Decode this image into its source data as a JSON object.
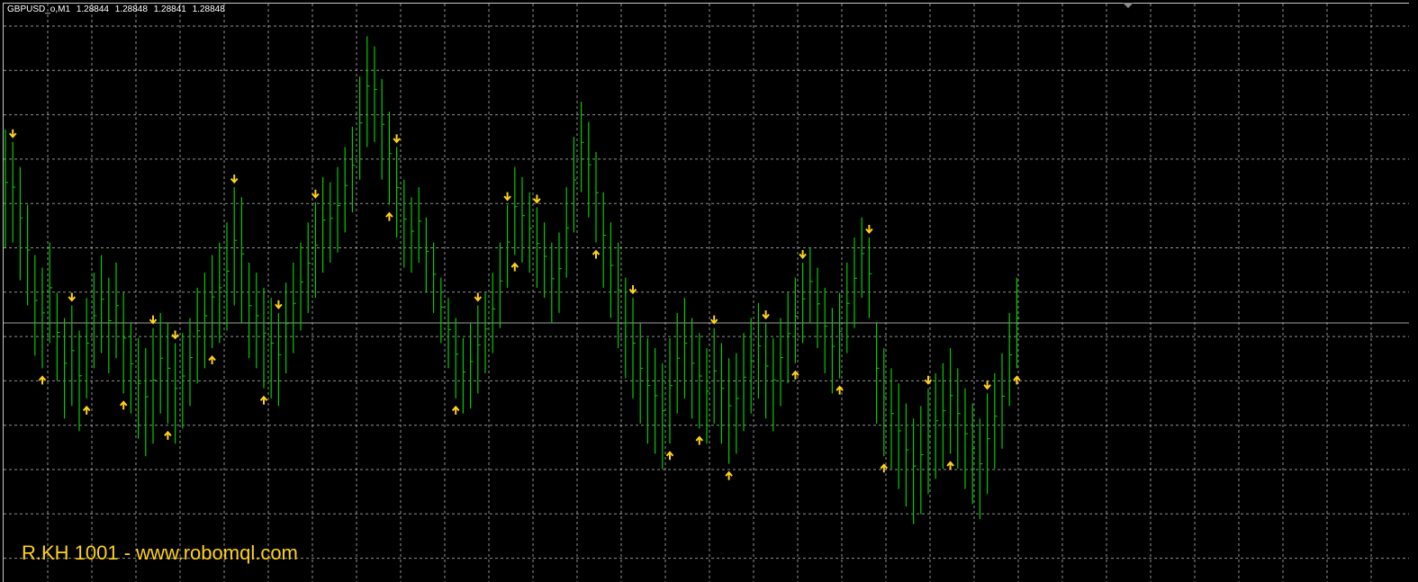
{
  "chart": {
    "symbol": "GBPUSD_o,M1",
    "open": "1.28844",
    "high": "1.28848",
    "low": "1.28841",
    "close": "1.28848",
    "watermark": "R.KH 1001 - www.robomql.com",
    "current_price": 1.28848,
    "colors": {
      "background": "#000000",
      "grid": "#c0c0c0",
      "bars": "#00cc00",
      "signals": "#ffd21a",
      "price_line": "#a0a0a0",
      "watermark": "#ffd21a"
    },
    "icons": {
      "buy_signal": "arrow-up-icon",
      "sell_signal": "arrow-down-icon",
      "shift": "chart-shift-triangle-icon"
    }
  },
  "chart_data": {
    "type": "ohlc",
    "title": "GBPUSD_o,M1",
    "grid": true,
    "ylim": [
      1.28745,
      1.28975
    ],
    "bars": [
      [
        1.28925,
        1.28878
      ],
      [
        1.2892,
        1.2888
      ],
      [
        1.2891,
        1.28865
      ],
      [
        1.28895,
        1.28855
      ],
      [
        1.28875,
        1.28835
      ],
      [
        1.2887,
        1.2883
      ],
      [
        1.2888,
        1.2884
      ],
      [
        1.2886,
        1.28825
      ],
      [
        1.2885,
        1.2881
      ],
      [
        1.28855,
        1.28815
      ],
      [
        1.28845,
        1.28805
      ],
      [
        1.28858,
        1.28818
      ],
      [
        1.28868,
        1.2883
      ],
      [
        1.28875,
        1.28836
      ],
      [
        1.28866,
        1.28828
      ],
      [
        1.28872,
        1.28834
      ],
      [
        1.2886,
        1.2882
      ],
      [
        1.28848,
        1.28812
      ],
      [
        1.28842,
        1.28802
      ],
      [
        1.28838,
        1.28795
      ],
      [
        1.28846,
        1.288
      ],
      [
        1.28852,
        1.28812
      ],
      [
        1.28848,
        1.28808
      ],
      [
        1.2884,
        1.288
      ],
      [
        1.28844,
        1.28806
      ],
      [
        1.2885,
        1.28815
      ],
      [
        1.28862,
        1.28824
      ],
      [
        1.28868,
        1.2883
      ],
      [
        1.28875,
        1.28838
      ],
      [
        1.2888,
        1.2884
      ],
      [
        1.28888,
        1.28845
      ],
      [
        1.28902,
        1.28855
      ],
      [
        1.28898,
        1.28848
      ],
      [
        1.28872,
        1.28834
      ],
      [
        1.28868,
        1.2883
      ],
      [
        1.28862,
        1.28822
      ],
      [
        1.28858,
        1.28818
      ],
      [
        1.28852,
        1.28815
      ],
      [
        1.28864,
        1.28828
      ],
      [
        1.28872,
        1.28836
      ],
      [
        1.2888,
        1.28845
      ],
      [
        1.28888,
        1.28852
      ],
      [
        1.28896,
        1.28858
      ],
      [
        1.28906,
        1.28868
      ],
      [
        1.28904,
        1.28872
      ],
      [
        1.2891,
        1.28876
      ],
      [
        1.28918,
        1.28884
      ],
      [
        1.28926,
        1.28892
      ],
      [
        1.28946,
        1.28905
      ],
      [
        1.28962,
        1.28918
      ],
      [
        1.28958,
        1.2892
      ],
      [
        1.28945,
        1.28905
      ],
      [
        1.28932,
        1.28895
      ],
      [
        1.28918,
        1.28882
      ],
      [
        1.28905,
        1.2887
      ],
      [
        1.28898,
        1.28868
      ],
      [
        1.28902,
        1.28872
      ],
      [
        1.2889,
        1.2886
      ],
      [
        1.2888,
        1.28852
      ],
      [
        1.28866,
        1.2884
      ],
      [
        1.28858,
        1.2883
      ],
      [
        1.2885,
        1.28818
      ],
      [
        1.28842,
        1.28812
      ],
      [
        1.28848,
        1.28814
      ],
      [
        1.28855,
        1.2882
      ],
      [
        1.2886,
        1.28828
      ],
      [
        1.28868,
        1.28836
      ],
      [
        1.2888,
        1.28846
      ],
      [
        1.28895,
        1.28862
      ],
      [
        1.2891,
        1.28875
      ],
      [
        1.28906,
        1.28872
      ],
      [
        1.289,
        1.28868
      ],
      [
        1.28894,
        1.28862
      ],
      [
        1.28888,
        1.28858
      ],
      [
        1.2888,
        1.28848
      ],
      [
        1.28884,
        1.28852
      ],
      [
        1.28902,
        1.28866
      ],
      [
        1.28922,
        1.28884
      ],
      [
        1.28936,
        1.289
      ],
      [
        1.28928,
        1.2889
      ],
      [
        1.28916,
        1.2888
      ],
      [
        1.289,
        1.28862
      ],
      [
        1.28888,
        1.2885
      ],
      [
        1.2888,
        1.28838
      ],
      [
        1.28866,
        1.28826
      ],
      [
        1.28858,
        1.28818
      ],
      [
        1.28848,
        1.28808
      ],
      [
        1.28842,
        1.288
      ],
      [
        1.28838,
        1.28796
      ],
      [
        1.28832,
        1.2879
      ],
      [
        1.28842,
        1.288
      ],
      [
        1.28852,
        1.28812
      ],
      [
        1.28858,
        1.28818
      ],
      [
        1.2885,
        1.2881
      ],
      [
        1.28844,
        1.28806
      ],
      [
        1.28838,
        1.288
      ],
      [
        1.28846,
        1.28808
      ],
      [
        1.2884,
        1.288
      ],
      [
        1.28834,
        1.28792
      ],
      [
        1.28836,
        1.28796
      ],
      [
        1.28844,
        1.28805
      ],
      [
        1.2885,
        1.28812
      ],
      [
        1.28856,
        1.28818
      ],
      [
        1.28848,
        1.2881
      ],
      [
        1.28842,
        1.28805
      ],
      [
        1.2885,
        1.28815
      ],
      [
        1.2886,
        1.28824
      ],
      [
        1.28866,
        1.28832
      ],
      [
        1.28872,
        1.2884
      ],
      [
        1.28878,
        1.28848
      ],
      [
        1.2887,
        1.28838
      ],
      [
        1.28862,
        1.28828
      ],
      [
        1.28854,
        1.2882
      ],
      [
        1.2886,
        1.28826
      ],
      [
        1.28872,
        1.28836
      ],
      [
        1.28882,
        1.28846
      ],
      [
        1.2889,
        1.28858
      ],
      [
        1.28882,
        1.2885
      ],
      [
        1.28848,
        1.28808
      ],
      [
        1.28838,
        1.28795
      ],
      [
        1.2883,
        1.2879
      ],
      [
        1.28824,
        1.28782
      ],
      [
        1.28816,
        1.28775
      ],
      [
        1.2881,
        1.28768
      ],
      [
        1.28815,
        1.28772
      ],
      [
        1.28822,
        1.2878
      ],
      [
        1.28828,
        1.28786
      ],
      [
        1.28832,
        1.2879
      ],
      [
        1.28838,
        1.28796
      ],
      [
        1.2883,
        1.2879
      ],
      [
        1.28822,
        1.28782
      ],
      [
        1.28816,
        1.28776
      ],
      [
        1.2881,
        1.2877
      ],
      [
        1.2882,
        1.2878
      ],
      [
        1.28828,
        1.2879
      ],
      [
        1.28836,
        1.28798
      ],
      [
        1.28852,
        1.28815
      ],
      [
        1.28866,
        1.2883
      ]
    ],
    "buy_signals": [
      5,
      11,
      16,
      22,
      28,
      35,
      52,
      61,
      69,
      80,
      90,
      94,
      98,
      107,
      113,
      119,
      128,
      137
    ],
    "sell_signals": [
      1,
      9,
      20,
      23,
      31,
      37,
      42,
      53,
      64,
      68,
      72,
      85,
      96,
      103,
      108,
      117,
      125,
      133
    ]
  }
}
